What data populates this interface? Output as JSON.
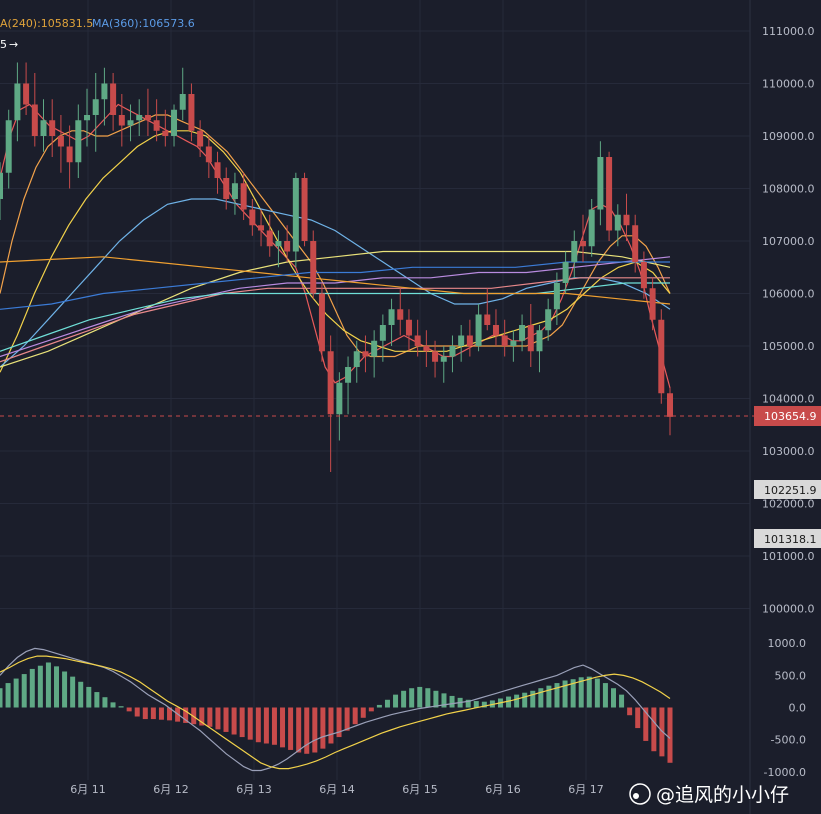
{
  "legend": {
    "ma240": "A(240):105831.5",
    "ma360": "MA(360):106573.6",
    "badge": "5"
  },
  "price_axis": {
    "ticks": [
      "111000.0",
      "110000.0",
      "109000.0",
      "108000.0",
      "107000.0",
      "106000.0",
      "105000.0",
      "104000.0",
      "103000.0",
      "102000.0",
      "101000.0",
      "100000.0"
    ],
    "current_price": "103654.9",
    "level_1": "102251.9",
    "level_2": "101318.1"
  },
  "macd_axis": {
    "ticks": [
      "1000.0",
      "500.0",
      "0.0",
      "-500.0",
      "-1000.0"
    ]
  },
  "x_axis": {
    "labels": [
      "6月 11",
      "6月 12",
      "6月 13",
      "6月 14",
      "6月 15",
      "6月 16",
      "6月 17"
    ]
  },
  "watermark": "@追风的小小仔",
  "colors": {
    "background": "#1b1e2b",
    "up": "#5fa985",
    "down": "#c84b4b",
    "grid": "#262a3a",
    "price_tag": "#c84b4b"
  },
  "chart_data": {
    "type": "candlestick",
    "title": "",
    "ylim": [
      99400,
      111400
    ],
    "macd_ylim": [
      -1050,
      1050
    ],
    "x": [
      "6月 11",
      "6月 12",
      "6月 13",
      "6月 14",
      "6月 15",
      "6月 16",
      "6月 17"
    ],
    "candles": [
      [
        107800,
        108500,
        107400,
        108300
      ],
      [
        108300,
        109500,
        108000,
        109300
      ],
      [
        109300,
        110400,
        108900,
        110000
      ],
      [
        110000,
        110400,
        109400,
        109600
      ],
      [
        109600,
        110200,
        108800,
        109000
      ],
      [
        109000,
        109700,
        108700,
        109300
      ],
      [
        109300,
        109700,
        108600,
        109000
      ],
      [
        109000,
        109400,
        108300,
        108800
      ],
      [
        108800,
        109200,
        108000,
        108500
      ],
      [
        108500,
        109600,
        108200,
        109300
      ],
      [
        109300,
        109900,
        108800,
        109400
      ],
      [
        109400,
        110200,
        108700,
        109700
      ],
      [
        109700,
        110300,
        109200,
        110000
      ],
      [
        110000,
        110200,
        109100,
        109400
      ],
      [
        109400,
        109800,
        108800,
        109200
      ],
      [
        109200,
        109600,
        108900,
        109300
      ],
      [
        109300,
        109700,
        109000,
        109400
      ],
      [
        109400,
        109900,
        109000,
        109300
      ],
      [
        109300,
        109700,
        108900,
        109100
      ],
      [
        109100,
        109500,
        108800,
        109000
      ],
      [
        109000,
        109600,
        108800,
        109500
      ],
      [
        109500,
        110300,
        109300,
        109800
      ],
      [
        109800,
        110000,
        108900,
        109100
      ],
      [
        109100,
        109300,
        108600,
        108800
      ],
      [
        108800,
        109000,
        108200,
        108500
      ],
      [
        108500,
        108700,
        107900,
        108200
      ],
      [
        108200,
        108400,
        107600,
        107800
      ],
      [
        107800,
        108300,
        107500,
        108100
      ],
      [
        108100,
        108300,
        107400,
        107600
      ],
      [
        107600,
        107800,
        107100,
        107300
      ],
      [
        107300,
        107600,
        106900,
        107200
      ],
      [
        107200,
        107500,
        106700,
        106900
      ],
      [
        106900,
        107200,
        106500,
        107000
      ],
      [
        107000,
        107300,
        106600,
        106800
      ],
      [
        106800,
        108300,
        106500,
        108200
      ],
      [
        108200,
        108300,
        106900,
        107000
      ],
      [
        107000,
        107200,
        105900,
        106000
      ],
      [
        106000,
        106200,
        104700,
        104900
      ],
      [
        104900,
        105200,
        102600,
        103700
      ],
      [
        103700,
        104500,
        103200,
        104300
      ],
      [
        104300,
        104800,
        103700,
        104600
      ],
      [
        104600,
        105100,
        104300,
        104900
      ],
      [
        104900,
        105200,
        104500,
        104800
      ],
      [
        104800,
        105300,
        104400,
        105100
      ],
      [
        105100,
        105600,
        104700,
        105400
      ],
      [
        105400,
        105900,
        105000,
        105700
      ],
      [
        105700,
        106100,
        105200,
        105500
      ],
      [
        105500,
        105700,
        104900,
        105200
      ],
      [
        105200,
        105500,
        104800,
        105000
      ],
      [
        105000,
        105300,
        104600,
        104900
      ],
      [
        104900,
        105100,
        104400,
        104700
      ],
      [
        104700,
        105000,
        104300,
        104800
      ],
      [
        104800,
        105200,
        104500,
        105000
      ],
      [
        105000,
        105400,
        104700,
        105200
      ],
      [
        105200,
        105500,
        104800,
        105000
      ],
      [
        105000,
        105800,
        104900,
        105600
      ],
      [
        105600,
        106100,
        105300,
        105400
      ],
      [
        105400,
        105700,
        105000,
        105200
      ],
      [
        105200,
        105500,
        104800,
        105000
      ],
      [
        105000,
        105300,
        104700,
        105100
      ],
      [
        105100,
        105600,
        104900,
        105400
      ],
      [
        105400,
        105800,
        104600,
        104900
      ],
      [
        104900,
        105400,
        104500,
        105300
      ],
      [
        105300,
        105900,
        105100,
        105700
      ],
      [
        105700,
        106400,
        105400,
        106200
      ],
      [
        106200,
        106800,
        106000,
        106600
      ],
      [
        106600,
        107200,
        106300,
        107000
      ],
      [
        107000,
        107500,
        106600,
        106900
      ],
      [
        106900,
        107800,
        106700,
        107600
      ],
      [
        107600,
        108900,
        107300,
        108600
      ],
      [
        108600,
        108700,
        107000,
        107200
      ],
      [
        107200,
        107700,
        106900,
        107500
      ],
      [
        107500,
        107900,
        107000,
        107300
      ],
      [
        107300,
        107500,
        106400,
        106600
      ],
      [
        106600,
        106800,
        105900,
        106100
      ],
      [
        106100,
        106300,
        105300,
        105500
      ],
      [
        105500,
        105700,
        103900,
        104100
      ],
      [
        104100,
        104200,
        103300,
        103650
      ]
    ],
    "series": [
      {
        "name": "MA(240)",
        "value": 105831.5
      },
      {
        "name": "MA(360)",
        "value": 106573.6
      }
    ],
    "price_levels": [
      103654.9,
      102251.9,
      101318.1
    ],
    "macd_hist": [
      300,
      380,
      450,
      520,
      600,
      650,
      700,
      640,
      560,
      480,
      400,
      320,
      240,
      160,
      80,
      20,
      -60,
      -140,
      -180,
      -180,
      -190,
      -200,
      -220,
      -240,
      -260,
      -280,
      -300,
      -340,
      -380,
      -420,
      -460,
      -500,
      -540,
      -560,
      -580,
      -620,
      -660,
      -700,
      -720,
      -700,
      -640,
      -560,
      -460,
      -360,
      -260,
      -160,
      -60,
      40,
      120,
      200,
      260,
      300,
      320,
      300,
      260,
      220,
      180,
      150,
      120,
      100,
      90,
      110,
      140,
      170,
      200,
      230,
      260,
      300,
      340,
      380,
      420,
      440,
      470,
      480,
      450,
      380,
      300,
      200,
      -120,
      -320,
      -520,
      -680,
      -760,
      -860
    ],
    "macd_line": [
      500,
      650,
      780,
      870,
      920,
      900,
      860,
      820,
      780,
      740,
      700,
      660,
      620,
      560,
      480,
      400,
      300,
      200,
      120,
      40,
      -60,
      -160,
      -260,
      -360,
      -480,
      -600,
      -720,
      -820,
      -920,
      -980,
      -980,
      -940,
      -880,
      -800,
      -700,
      -600,
      -520,
      -460,
      -420,
      -380,
      -330,
      -280,
      -230,
      -190,
      -150,
      -110,
      -80,
      -50,
      -20,
      0,
      20,
      40,
      60,
      80,
      100,
      140,
      180,
      220,
      260,
      300,
      340,
      380,
      420,
      460,
      500,
      560,
      620,
      660,
      600,
      520,
      440,
      360,
      260,
      120,
      -40,
      -200,
      -360,
      -480
    ],
    "signal_line": [
      550,
      620,
      700,
      760,
      800,
      800,
      780,
      760,
      730,
      700,
      670,
      640,
      600,
      550,
      480,
      400,
      300,
      200,
      100,
      20,
      -60,
      -160,
      -260,
      -360,
      -460,
      -560,
      -660,
      -760,
      -860,
      -920,
      -950,
      -950,
      -920,
      -880,
      -830,
      -770,
      -700,
      -640,
      -580,
      -520,
      -460,
      -400,
      -350,
      -300,
      -260,
      -220,
      -180,
      -140,
      -100,
      -70,
      -40,
      -10,
      20,
      50,
      80,
      110,
      150,
      190,
      230,
      270,
      310,
      350,
      390,
      430,
      470,
      500,
      520,
      500,
      460,
      400,
      320,
      240,
      140
    ],
    "ma_lines": [
      {
        "color": "#e85a5a",
        "values": [
          108200,
          109000,
          109500,
          109600,
          109400,
          109200,
          109100,
          109000,
          108900,
          109000,
          109200,
          109400,
          109600,
          109500,
          109400,
          109300,
          109200,
          109100,
          109000,
          108900,
          108800,
          108600,
          108300,
          108000,
          107700,
          107500,
          107300,
          107100,
          106900,
          106700,
          106500,
          106000,
          105300,
          104600,
          104300,
          104400,
          104600,
          104800,
          104900,
          105000,
          105100,
          105200,
          105100,
          105000,
          104900,
          104800,
          104800,
          104900,
          105000,
          105100,
          105200,
          105200,
          105100,
          105100,
          105200,
          105300,
          105500,
          105900,
          106400,
          107000,
          107600,
          107700,
          107600,
          107300,
          106900,
          106400,
          105600,
          104900,
          104200
        ]
      },
      {
        "color": "#f2a24a",
        "values": [
          106000,
          107000,
          107800,
          108400,
          108800,
          109000,
          109100,
          109100,
          109000,
          109000,
          109100,
          109200,
          109300,
          109400,
          109400,
          109300,
          109200,
          109100,
          108900,
          108700,
          108400,
          108100,
          107800,
          107500,
          107200,
          106900,
          106600,
          106200,
          105700,
          105200,
          104900,
          104800,
          104800,
          104800,
          104900,
          105000,
          105000,
          105000,
          105000,
          105000,
          105000,
          105000,
          105000,
          105000,
          105000,
          105100,
          105200,
          105400,
          105800,
          106200,
          106600,
          106900,
          107100,
          107100,
          106900,
          106500,
          106000
        ]
      },
      {
        "color": "#f2d24a",
        "values": [
          104500,
          105200,
          106000,
          106700,
          107300,
          107800,
          108200,
          108500,
          108800,
          109000,
          109100,
          109100,
          109000,
          108700,
          108300,
          107700,
          107100,
          106500,
          106000,
          105600,
          105300,
          105100,
          105000,
          104900,
          104900,
          104900,
          104900,
          105000,
          105100,
          105200,
          105300,
          105400,
          105500,
          105700,
          106000,
          106300,
          106500,
          106600,
          106400,
          106000
        ]
      },
      {
        "color": "#6fb3e8",
        "values": [
          104600,
          105000,
          105500,
          106000,
          106500,
          107000,
          107400,
          107700,
          107800,
          107800,
          107700,
          107600,
          107500,
          107400,
          107200,
          106900,
          106600,
          106300,
          106000,
          105800,
          105800,
          105900,
          106100,
          106200,
          106300,
          106300,
          106200,
          106000,
          105700
        ]
      },
      {
        "color": "#e9e27a",
        "values": [
          104600,
          104900,
          105300,
          105700,
          106100,
          106400,
          106600,
          106700,
          106800,
          106800,
          106800,
          106800,
          106800,
          106700,
          106500
        ]
      },
      {
        "color": "#b98be0",
        "values": [
          104800,
          105100,
          105400,
          105700,
          105900,
          106100,
          106200,
          106200,
          106300,
          106300,
          106400,
          106400,
          106500,
          106600,
          106700
        ]
      },
      {
        "color": "#e8888a",
        "values": [
          104700,
          105000,
          105300,
          105600,
          105800,
          106000,
          106100,
          106100,
          106100,
          106100,
          106100,
          106100,
          106200,
          106300,
          106300,
          106300
        ]
      },
      {
        "color": "#6fe0d8",
        "values": [
          104900,
          105200,
          105500,
          105700,
          105900,
          106000,
          106000,
          106000,
          106000,
          106000,
          106000,
          106000,
          106000,
          106100,
          106200,
          106200
        ]
      },
      {
        "color": "#f0a030",
        "values": [
          106600,
          106650,
          106700,
          106600,
          106500,
          106400,
          106300,
          106200,
          106100,
          106000,
          106000,
          106000,
          105900,
          105800
        ]
      },
      {
        "color": "#3b7bd6",
        "values": [
          105700,
          105800,
          106000,
          106100,
          106200,
          106300,
          106400,
          106400,
          106500,
          106500,
          106500,
          106600,
          106600,
          106600
        ]
      }
    ]
  }
}
